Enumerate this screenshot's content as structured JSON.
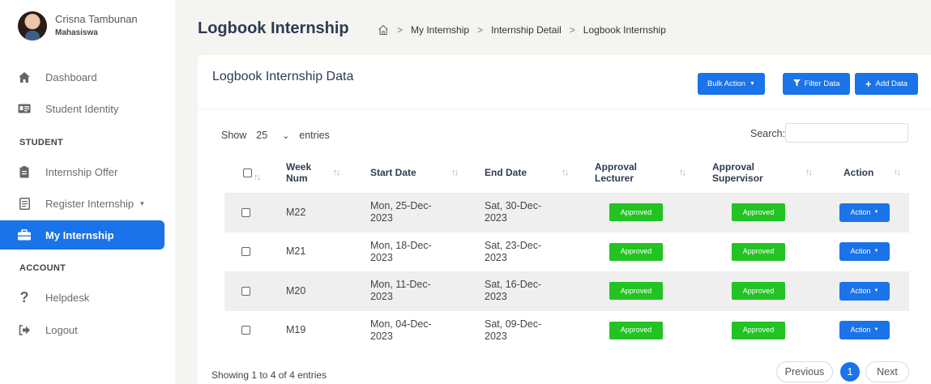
{
  "user": {
    "name": "Crisna Tambunan",
    "role": "Mahasiswa"
  },
  "sidebar": {
    "items": [
      {
        "label": "Dashboard"
      },
      {
        "label": "Student Identity"
      },
      {
        "label": "Internship Offer"
      },
      {
        "label": "Register Internship"
      },
      {
        "label": "My Internship"
      },
      {
        "label": "Helpdesk"
      },
      {
        "label": "Logout"
      }
    ],
    "sections": [
      "STUDENT",
      "ACCOUNT"
    ]
  },
  "header": {
    "title": "Logbook Internship",
    "breadcrumb": [
      "My Internship",
      "Internship Detail",
      "Logbook Internship"
    ]
  },
  "card": {
    "title": "Logbook Internship Data",
    "bulk_action": "Bulk Action",
    "filter": "Filter Data",
    "add": "Add Data"
  },
  "table_controls": {
    "show": "Show",
    "entries_value": "25",
    "entries": "entries",
    "search_label": "Search:",
    "search_value": ""
  },
  "table": {
    "headers": {
      "week_num": "Week Num",
      "start_date": "Start Date",
      "end_date": "End Date",
      "approval_lecturer": "Approval Lecturer",
      "approval_supervisor": "Approval Supervisor",
      "action": "Action"
    },
    "rows": [
      {
        "week": "M22",
        "start": "Mon, 25-Dec-2023",
        "end": "Sat, 30-Dec-2023",
        "lecturer": "Approved",
        "supervisor": "Approved",
        "action": "Action"
      },
      {
        "week": "M21",
        "start": "Mon, 18-Dec-2023",
        "end": "Sat, 23-Dec-2023",
        "lecturer": "Approved",
        "supervisor": "Approved",
        "action": "Action"
      },
      {
        "week": "M20",
        "start": "Mon, 11-Dec-2023",
        "end": "Sat, 16-Dec-2023",
        "lecturer": "Approved",
        "supervisor": "Approved",
        "action": "Action"
      },
      {
        "week": "M19",
        "start": "Mon, 04-Dec-2023",
        "end": "Sat, 09-Dec-2023",
        "lecturer": "Approved",
        "supervisor": "Approved",
        "action": "Action"
      }
    ]
  },
  "footer": {
    "showing": "Showing 1 to 4 of 4 entries",
    "previous": "Previous",
    "current_page": "1",
    "next": "Next"
  },
  "colors": {
    "primary": "#1a73e8",
    "approved": "#22c322",
    "background": "#f4f4f1"
  }
}
